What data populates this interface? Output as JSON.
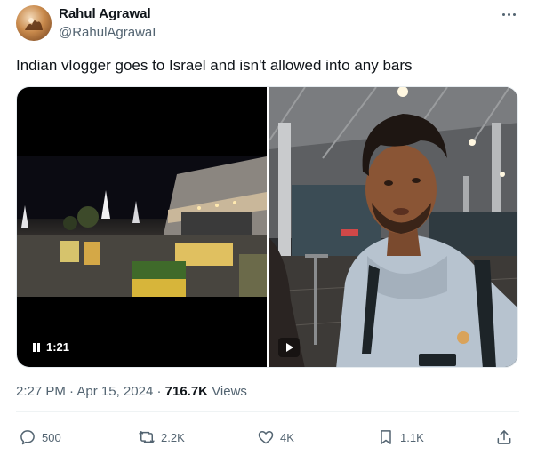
{
  "author": {
    "name": "Rahul Agrawal",
    "handle": "@RahulAgrawaI"
  },
  "tweet": {
    "text": "Indian vlogger goes to Israel and isn't allowed into any bars"
  },
  "media": {
    "video_duration": "1:21"
  },
  "meta": {
    "time": "2:27 PM",
    "separator": "·",
    "date": "Apr 15, 2024",
    "views_count": "716.7K",
    "views_label": "Views"
  },
  "actions": {
    "reply_count": "500",
    "repost_count": "2.2K",
    "like_count": "4K",
    "bookmark_count": "1.1K"
  },
  "icons": [
    "more-icon",
    "pause-icon",
    "play-icon",
    "reply-icon",
    "repost-icon",
    "like-icon",
    "bookmark-icon",
    "share-icon"
  ],
  "colors": {
    "text_primary": "#0f1419",
    "text_secondary": "#536471",
    "divider": "#eff3f4"
  }
}
